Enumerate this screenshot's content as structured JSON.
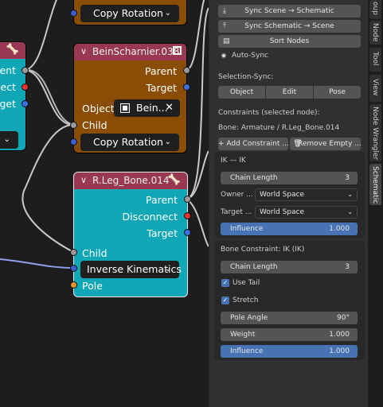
{
  "node_editor": {
    "left_node": {
      "sockets": [
        "Parent",
        "Disconnect",
        "Target"
      ]
    },
    "top_node": {
      "action": "Copy Rotation"
    },
    "beinscharnier_node": {
      "title": "BeinScharnier.038",
      "outputs": [
        "Parent",
        "Target"
      ],
      "object_label": "Object:",
      "object_value": "Bein...",
      "child_label": "Child",
      "action": "Copy Rotation"
    },
    "leg_node": {
      "title": "R.Leg_Bone.014",
      "outputs": [
        "Parent",
        "Disconnect",
        "Target"
      ],
      "child_label": "Child",
      "action": "Inverse Kinematics",
      "pole_label": "Pole"
    }
  },
  "sidebar": {
    "sync_scene_btn": "Sync Scene → Schematic",
    "sync_schematic_btn": "Sync Schematic → Scene",
    "sort_nodes_btn": "Sort Nodes",
    "auto_sync_label": "Auto-Sync",
    "selection_sync_label": "Selection-Sync:",
    "selection_modes": [
      "Object",
      "Edit",
      "Pose"
    ],
    "constraints_header": "Constraints (selected node):",
    "bone_label": "Bone: Armature / R.Leg_Bone.014",
    "add_constraint_btn": "+ Add Constraint ...",
    "remove_empty_btn": "Remove Empty ...",
    "ik_panel": {
      "title": "IK — IK",
      "chain_length_label": "Chain Length",
      "chain_length_value": "3",
      "owner_label": "Owner ...",
      "owner_value": "World Space",
      "target_label": "Target ...",
      "target_value": "World Space",
      "influence_label": "Influence",
      "influence_value": "1.000"
    },
    "bone_constraint_panel": {
      "title": "Bone Constraint: IK (IK)",
      "chain_length_label": "Chain Length",
      "chain_length_value": "3",
      "use_tail_label": "Use Tail",
      "stretch_label": "Stretch",
      "pole_angle_label": "Pole Angle",
      "pole_angle_value": "90°",
      "weight_label": "Weight",
      "weight_value": "1.000",
      "influence_label": "Influence",
      "influence_value": "1.000"
    }
  },
  "vertical_tabs": [
    "oup",
    "Node",
    "Tool",
    "View",
    "Node Wrangler",
    "Schematic"
  ],
  "colors": {
    "node_header": "#993852",
    "node_orange": "#8a4d06",
    "node_cyan": "#0fa6b6",
    "accent_blue": "#4772b3",
    "panel_bg": "#303030"
  }
}
